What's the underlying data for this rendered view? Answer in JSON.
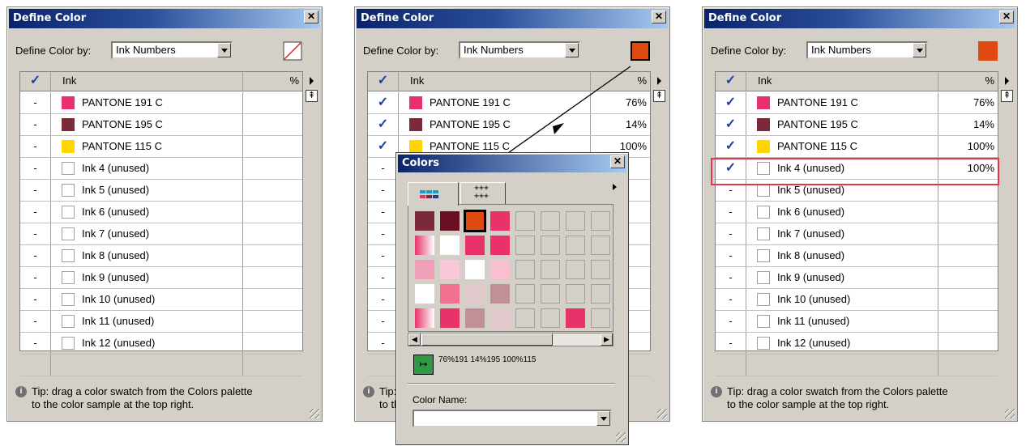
{
  "dialog": {
    "title": "Define Color",
    "close_glyph": "✕",
    "define_label": "Define Color by:",
    "define_value": "Ink Numbers",
    "col_ink": "Ink",
    "col_pct": "%",
    "tip": "Tip: drag a color swatch  from the Colors palette",
    "tip2": "to the color sample at the top right.",
    "tip_icon": "info-icon"
  },
  "inks": [
    {
      "name": "PANTONE 191 C",
      "color": "#e8336a"
    },
    {
      "name": "PANTONE 195 C",
      "color": "#7b2a3a"
    },
    {
      "name": "PANTONE 115 C",
      "color": "#ffd500"
    },
    {
      "name": "Ink 4 (unused)",
      "color": ""
    },
    {
      "name": "Ink 5 (unused)",
      "color": ""
    },
    {
      "name": "Ink 6 (unused)",
      "color": ""
    },
    {
      "name": "Ink 7 (unused)",
      "color": ""
    },
    {
      "name": "Ink 8 (unused)",
      "color": ""
    },
    {
      "name": "Ink 9 (unused)",
      "color": ""
    },
    {
      "name": "Ink 10 (unused)",
      "color": ""
    },
    {
      "name": "Ink 11 (unused)",
      "color": ""
    },
    {
      "name": "Ink 12 (unused)",
      "color": ""
    }
  ],
  "panel1": {
    "checks": [
      "-",
      "-",
      "-",
      "-",
      "-",
      "-",
      "-",
      "-",
      "-",
      "-",
      "-",
      "-"
    ],
    "pcts": [
      "",
      "",
      "",
      "",
      "",
      "",
      "",
      "",
      "",
      "",
      "",
      ""
    ]
  },
  "panel2": {
    "checks": [
      "✓",
      "✓",
      "✓",
      "-",
      "-",
      "-",
      "-",
      "-",
      "-",
      "-",
      "-",
      "-"
    ],
    "pcts": [
      "76%",
      "14%",
      "100%",
      "",
      "",
      "",
      "",
      "",
      "",
      "",
      "",
      ""
    ]
  },
  "panel3": {
    "checks": [
      "✓",
      "✓",
      "✓",
      "✓",
      "-",
      "-",
      "-",
      "-",
      "-",
      "-",
      "-",
      "-"
    ],
    "pcts": [
      "76%",
      "14%",
      "100%",
      "100%",
      "",
      "",
      "",
      "",
      "",
      "",
      "",
      ""
    ]
  },
  "sample_color": "#e04a12",
  "palette": {
    "title": "Colors",
    "close_glyph": "✕",
    "tab2_label": "+++\n+++",
    "summary": "76%191 14%195 100%115",
    "color_name_label": "Color Name:",
    "color_name_value": "",
    "swatches": [
      [
        "#7b2a3a",
        "#6b0f24",
        "#e04a12",
        "#e8336a",
        "",
        "",
        "",
        ""
      ],
      [
        "grad",
        "#ffffff",
        "#e8336a",
        "#e8336a",
        "",
        "",
        "",
        ""
      ],
      [
        "#f0a0b8",
        "#f8c8d8",
        "#ffffff",
        "#f8c0d0",
        "",
        "",
        "",
        ""
      ],
      [
        "#ffffff",
        "#f07090",
        "#e0c8cc",
        "#c09098",
        "",
        "",
        "",
        ""
      ],
      [
        "grad",
        "#e8336a",
        "#c09098",
        "#e0c8cc",
        "",
        "",
        "#e8336a",
        ""
      ]
    ]
  }
}
